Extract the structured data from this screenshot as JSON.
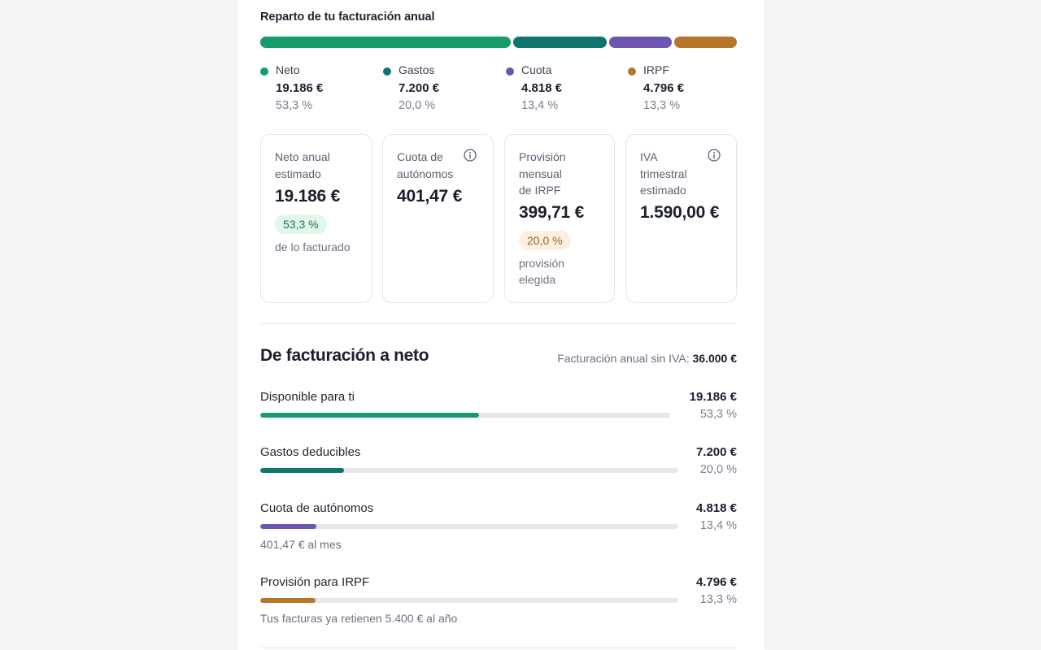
{
  "split": {
    "title": "Reparto de tu facturación anual",
    "segments": [
      {
        "name": "Neto",
        "fraction": 0.533,
        "color": "#169c6b"
      },
      {
        "name": "Gastos",
        "fraction": 0.2,
        "color": "#0f766e"
      },
      {
        "name": "Cuota",
        "fraction": 0.134,
        "color": "#6d55b0"
      },
      {
        "name": "IRPF",
        "fraction": 0.133,
        "color": "#b7772a"
      }
    ],
    "legend": [
      {
        "name": "Neto",
        "amount": "19.186 €",
        "pct": "53,3 %",
        "color": "#169c6b"
      },
      {
        "name": "Gastos",
        "amount": "7.200 €",
        "pct": "20,0 %",
        "color": "#0f766e"
      },
      {
        "name": "Cuota",
        "amount": "4.818 €",
        "pct": "13,4 %",
        "color": "#6d55b0"
      },
      {
        "name": "IRPF",
        "amount": "4.796 €",
        "pct": "13,3 %",
        "color": "#b7772a"
      }
    ]
  },
  "cards": {
    "neto": {
      "label_1": "Neto anual",
      "label_2": "estimado",
      "value": "19.186 €",
      "badge": "53,3 %",
      "note": "de lo facturado"
    },
    "cuota": {
      "label_1": "Cuota de",
      "label_2": "autónomos",
      "value": "401,47 €",
      "icon": "info-icon"
    },
    "irpf": {
      "label_1": "Provisión",
      "label_2": "mensual",
      "label_3": "de IRPF",
      "value": "399,71 €",
      "badge": "20,0 %",
      "note_1": "provisión",
      "note_2": "elegida"
    },
    "iva": {
      "label_1": "IVA",
      "label_2": "trimestral",
      "label_3": "estimado",
      "value": "1.590,00 €",
      "icon": "info-icon"
    }
  },
  "breakdown": {
    "title": "De facturación a neto",
    "meta_label": "Facturación anual sin IVA:",
    "meta_value": "36.000 €",
    "rows": [
      {
        "label": "Disponible para ti",
        "amount": "19.186 €",
        "pct": "53,3 %",
        "fraction": 0.533,
        "color": "#169c6b",
        "note": ""
      },
      {
        "label": "Gastos deducibles",
        "amount": "7.200 €",
        "pct": "20,0 %",
        "fraction": 0.2,
        "color": "#0f766e",
        "note": ""
      },
      {
        "label": "Cuota de autónomos",
        "amount": "4.818 €",
        "pct": "13,4 %",
        "fraction": 0.134,
        "color": "#6d55b0",
        "note": "401,47 € al mes"
      },
      {
        "label": "Provisión para IRPF",
        "amount": "4.796 €",
        "pct": "13,3 %",
        "fraction": 0.133,
        "color": "#b7772a",
        "note": "Tus facturas ya retienen 5.400 € al año"
      }
    ]
  },
  "colors": {
    "badge_green_bg": "#e4f5ec",
    "badge_green_text": "#157a4f",
    "badge_amber_bg": "#fcf0e0",
    "badge_amber_text": "#9a6220"
  }
}
